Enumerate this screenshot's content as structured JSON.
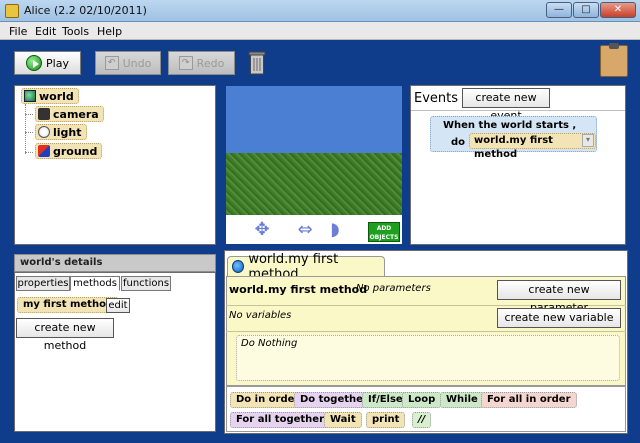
{
  "window": {
    "title": "Alice (2.2  02/10/2011)"
  },
  "menu": [
    "File",
    "Edit",
    "Tools",
    "Help"
  ],
  "toolbar": {
    "play": "Play",
    "undo": "Undo",
    "redo": "Redo"
  },
  "tree": {
    "world": "world",
    "camera": "camera",
    "light": "light",
    "ground": "ground"
  },
  "scene": {
    "add_objects": "ADD OBJECTS"
  },
  "events": {
    "title": "Events",
    "create_button": "create new event",
    "block_title": "When the world starts ,",
    "block_do": "do",
    "block_method": "world.my first method"
  },
  "details": {
    "title": "world's details",
    "tabs": [
      "properties",
      "methods",
      "functions"
    ],
    "method": "my first method",
    "edit": "edit",
    "create_method": "create new method"
  },
  "editor": {
    "tab_title": "world.my first method",
    "method_name": "world.my first method",
    "params": "No parameters",
    "create_param": "create new parameter",
    "vars": "No variables",
    "create_var": "create new variable",
    "body": "Do Nothing"
  },
  "palette": [
    "Do in order",
    "Do together",
    "If/Else",
    "Loop",
    "While",
    "For all in order",
    "For all together",
    "Wait",
    "print",
    "//"
  ],
  "colors": {
    "desktop_blue": "#0f3d8c",
    "method_yellow": "#fbf8c8",
    "object_tan": "#f3e4b5"
  }
}
